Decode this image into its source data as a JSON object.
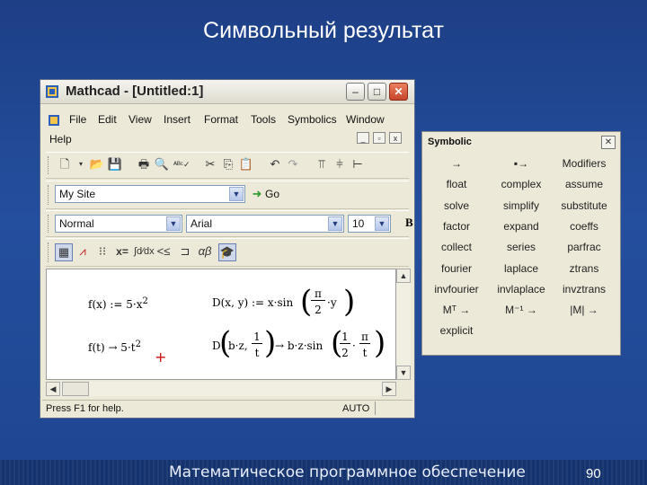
{
  "slide": {
    "title": "Символьный результат",
    "footer": "Математическое программное обеспечение",
    "page_number": "90"
  },
  "window": {
    "title": "Mathcad - [Untitled:1]",
    "minimize": "–",
    "maximize": "□",
    "close": "✕"
  },
  "menu": [
    "File",
    "Edit",
    "View",
    "Insert",
    "Format",
    "Tools",
    "Symbolics",
    "Window",
    "Help"
  ],
  "toolbar": {
    "site_combo": "My Site",
    "go_label": "Go",
    "style_combo": "Normal",
    "font_combo": "Arial",
    "size_combo": "10",
    "bold_label": "B"
  },
  "math": {
    "line1_left": "f(x) := 5·x",
    "line1_left_exp": "2",
    "line1_right_prefix": "D(x, y) := x·sin",
    "line1_right_num": "π",
    "line1_right_den": "2",
    "line1_right_suffix": "·y",
    "line2_left": "f(t) → 5·t",
    "line2_left_exp": "2",
    "line2_right_prefix": "D",
    "line2_right_arg": "b·z,",
    "line2_right_num": "1",
    "line2_right_den": "t",
    "line2_right_result": "→ b·z·sin",
    "line2_res_num1": "1",
    "line2_res_den1": "2",
    "line2_res_num2": "π",
    "line2_res_den2": "t",
    "line2_res_mid": "·",
    "cursor": "+"
  },
  "status": {
    "help": "Press F1 for help.",
    "mode": "AUTO"
  },
  "palette": {
    "title": "Symbolic",
    "close": "✕",
    "buttons": [
      [
        "→",
        "▪→",
        "Modifiers"
      ],
      [
        "float",
        "complex",
        "assume"
      ],
      [
        "solve",
        "simplify",
        "substitute"
      ],
      [
        "factor",
        "expand",
        "coeffs"
      ],
      [
        "collect",
        "series",
        "parfrac"
      ],
      [
        "fourier",
        "laplace",
        "ztrans"
      ],
      [
        "invfourier",
        "invlaplace",
        "invztrans"
      ],
      [
        "Mᵀ →",
        "M⁻¹ →",
        "|M| →"
      ],
      [
        "explicit"
      ]
    ]
  },
  "colors": {
    "background": "#1d3f86",
    "title_text": "#ffffff",
    "window_face": "#ece9d8",
    "close_button": "#c8452a"
  }
}
